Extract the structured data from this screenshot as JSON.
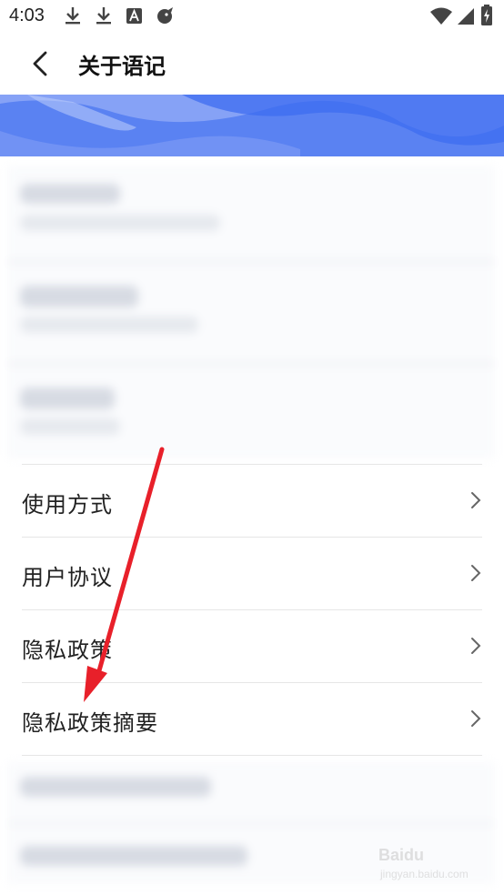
{
  "status_bar": {
    "time": "4:03",
    "left_icons": [
      "download-icon",
      "download-icon",
      "font-app-icon",
      "bird-app-icon"
    ],
    "right_icons": [
      "wifi-icon",
      "signal-icon",
      "battery-charging-icon"
    ]
  },
  "app_bar": {
    "back_icon": "back-arrow-icon",
    "title": "关于语记"
  },
  "menu": {
    "items": [
      {
        "label": "使用方式",
        "icon": "chevron-right-icon"
      },
      {
        "label": "用户协议",
        "icon": "chevron-right-icon"
      },
      {
        "label": "隐私政策",
        "icon": "chevron-right-icon"
      },
      {
        "label": "隐私政策摘要",
        "icon": "chevron-right-icon"
      }
    ]
  },
  "watermark": {
    "brand": "Baidu",
    "sub": "jingyan.baidu.com"
  },
  "colors": {
    "banner_blue": "#3d6cf0",
    "banner_light": "#7f9df5",
    "annotation_red": "#e8202a",
    "divider": "#e6e6e6"
  }
}
